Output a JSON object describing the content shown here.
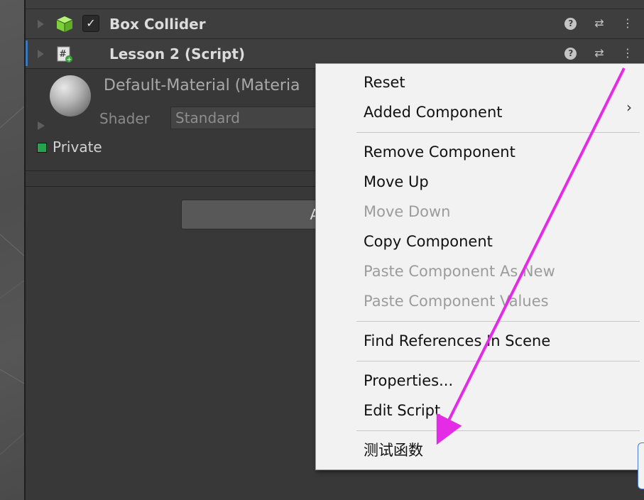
{
  "components": {
    "box_collider": {
      "title": "Box Collider",
      "checked": "✓"
    },
    "script": {
      "title": "Lesson 2 (Script)"
    }
  },
  "material": {
    "name": "Default-Material (Materia",
    "shader_label": "Shader",
    "shader_value": "Standard"
  },
  "fields": {
    "private_label": "Private"
  },
  "add_component_label": "Add C",
  "context_menu": {
    "items": [
      {
        "label": "Reset",
        "enabled": true
      },
      {
        "label": "Added Component",
        "enabled": true,
        "submenu": true
      },
      {
        "label": "Remove Component",
        "enabled": true
      },
      {
        "label": "Move Up",
        "enabled": true
      },
      {
        "label": "Move Down",
        "enabled": false
      },
      {
        "label": "Copy Component",
        "enabled": true
      },
      {
        "label": "Paste Component As New",
        "enabled": false
      },
      {
        "label": "Paste Component Values",
        "enabled": false
      },
      {
        "label": "Find References In Scene",
        "enabled": true
      },
      {
        "label": "Properties...",
        "enabled": true
      },
      {
        "label": "Edit Script",
        "enabled": true
      },
      {
        "label": "测试函数",
        "enabled": true
      }
    ],
    "submenu_glyph": "›"
  },
  "icons": {
    "help": "?",
    "presets": "⇄",
    "more": "⋮"
  },
  "colors": {
    "accent_blue": "#3a79bb",
    "annotation_magenta": "#e42ce6",
    "private_green": "#27a350"
  }
}
